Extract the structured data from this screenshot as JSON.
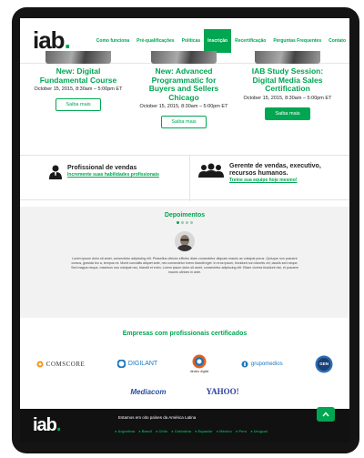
{
  "header": {
    "logo_text": "iab",
    "logo_dot": ".",
    "nav": [
      {
        "label": "Como funciona",
        "active": false
      },
      {
        "label": "Pré-qualificações",
        "active": false
      },
      {
        "label": "Políticas",
        "active": false
      },
      {
        "label": "Inscrição",
        "active": true
      },
      {
        "label": "Recertificação",
        "active": false
      },
      {
        "label": "Perguntas Frequentes",
        "active": false
      },
      {
        "label": "Contato",
        "active": false
      }
    ]
  },
  "events": [
    {
      "title": "New: Digital Fundamental Course",
      "date": "October 15, 2015, 8:30am – 5:00pm ET",
      "button": "Saiba mais",
      "filled": false
    },
    {
      "title": "New: Advanced Programmatic for Buyers and Sellers Chicago",
      "date": "October 15, 2015, 8:30am – 5:00pm ET",
      "button": "Saiba mais",
      "filled": false
    },
    {
      "title": "IAB Study Session: Digital Media Sales Certification",
      "date": "October 15, 2015, 8:30am – 5:00pm ET",
      "button": "Saiba mais",
      "filled": true
    }
  ],
  "professional": {
    "left": {
      "title": "Profissional de vendas",
      "link": "Incremente suas habilidades profissionais"
    },
    "right": {
      "title": "Gerente de vendas, executivo, recursos humanos.",
      "link": "Treine sua equipe hoje mesmo!"
    }
  },
  "testimonials": {
    "title": "Depoimentos",
    "dots": 4,
    "active_dot": 0,
    "text": "Lorem ipsum dolor sit amet, consectetur adipiscing elit. Phasellus ultrices efficitur diam consectetur aliquam mauris ac volutpat purus. Quisque non posuere cursus, gravida leo a, tempus mi. Morbi convallis aliquet ante, nec consectetur lorem blandit eget. In eros ipsum, tincidunt non lobortis vel, iaculis sed neque. Sed magna neque, maximus non volutpat nec, blandit et enim. Lorem ipsum dolor sit amet, consectetur adipiscing elit. Etiam viverra tincidunt nisi, et posuere mauris ultrices in ante."
  },
  "partners": {
    "title": "Empresas com profissionais certificados",
    "row1": [
      {
        "name": "comScore",
        "label": "COMSCORE",
        "color": "#f7941d"
      },
      {
        "name": "digilant",
        "label": "DIGILANT",
        "color": "#1b75bc"
      },
      {
        "name": "dinako",
        "label": "dinako digital",
        "color": "#e8601c"
      },
      {
        "name": "grupomedios",
        "label": "grupomedios",
        "color": "#1b75bc"
      },
      {
        "name": "gen",
        "label": "GEN",
        "color": "#2a6fb5"
      }
    ],
    "row2": [
      {
        "name": "mediacom",
        "label": "Mediacom",
        "color": "#2a4fa0"
      },
      {
        "name": "yahoo",
        "label": "YAHOO!",
        "color": "#2c3e9a"
      }
    ]
  },
  "footer": {
    "logo_text": "iab",
    "logo_dot": ".",
    "title": "Estamos em oito países da América Latina",
    "countries": [
      "Argentina",
      "Brasil",
      "Chile",
      "Colômbia",
      "Equador",
      "México",
      "Peru",
      "Uruguai"
    ]
  },
  "colors": {
    "brand": "#00a651",
    "footer_bg": "#111111"
  }
}
